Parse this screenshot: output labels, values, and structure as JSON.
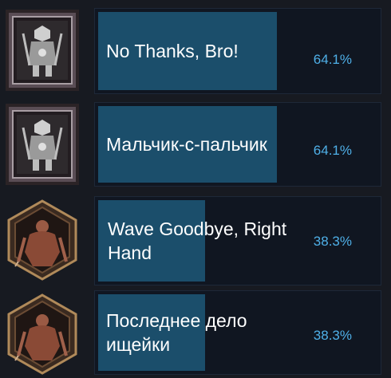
{
  "achievements": [
    {
      "name": "No Thanks, Bro!",
      "percent": "64.1%",
      "progress": 0.641,
      "icon": "armored-knight-icon"
    },
    {
      "name": "Мальчик-с-пальчик",
      "percent": "64.1%",
      "progress": 0.641,
      "icon": "armored-knight-icon"
    },
    {
      "name": "Wave Goodbye, Right Hand",
      "percent": "38.3%",
      "progress": 0.383,
      "icon": "flayed-giant-icon"
    },
    {
      "name": "Последнее дело ищейки",
      "percent": "38.3%",
      "progress": 0.383,
      "icon": "flayed-giant-icon"
    }
  ],
  "colors": {
    "background": "#171a21",
    "card": "#101621",
    "progress_fill": "#1b4e6b",
    "percent_text": "#4fb0e8"
  }
}
